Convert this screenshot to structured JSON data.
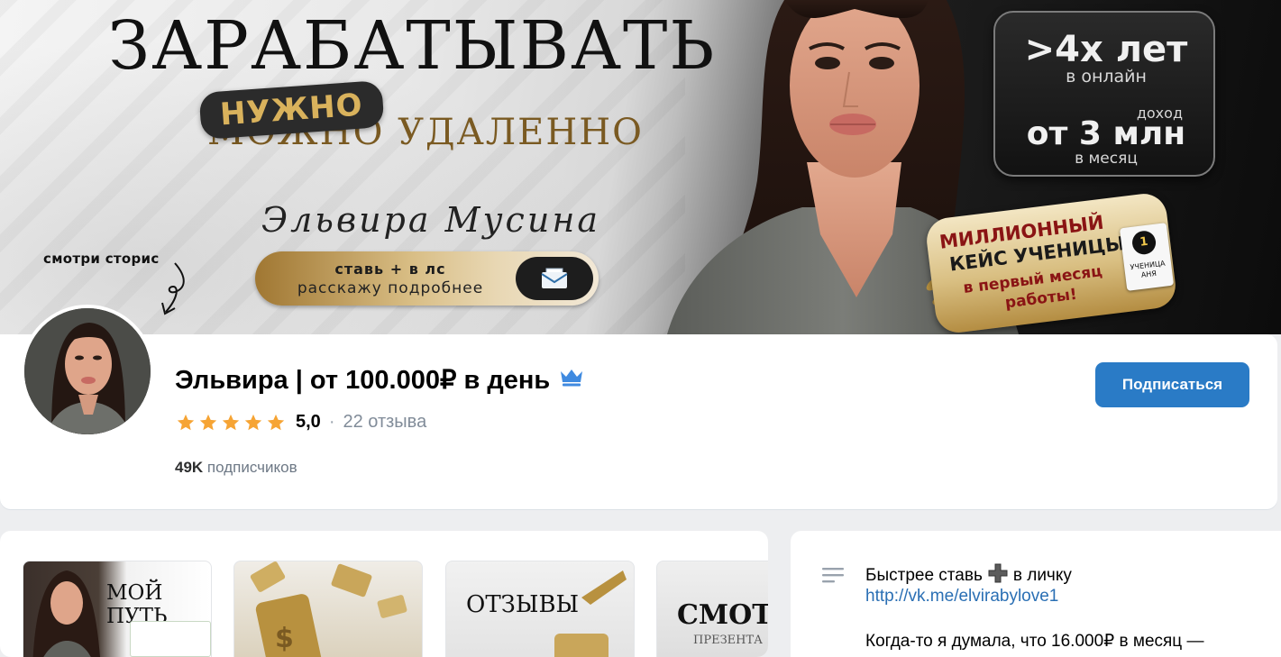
{
  "cover": {
    "headline": "ЗАРАБАТЫВАТЬ",
    "badge": "НУЖНО",
    "subline": "МОЖНО УДАЛЕННО",
    "signature": "Эльвира Мусина",
    "cta_line1": "ставь + в лс",
    "cta_line2": "расскажу подробнее",
    "watch_stories": "смотри сторис",
    "stat_years": ">4х лет",
    "stat_years_sub": "в онлайн",
    "stat_income_pre": "доход",
    "stat_income": "от 3 млн",
    "stat_income_sub": "в месяц",
    "case_l1": "МИЛЛИОННЫЙ",
    "case_l2": "КЕЙС УЧЕНИЦЫ",
    "case_l3": "в первый месяц",
    "case_l4": "работы!",
    "case_photo_num": "1",
    "case_photo_caption": "УЧЕНИЦА АНЯ"
  },
  "profile": {
    "name": "Эльвира | от 100.000₽ в день",
    "rating_value": "5,0",
    "rating_stars": 5,
    "rating_separator": "·",
    "reviews": "22 отзыва",
    "followers_count": "49K",
    "followers_label": "подписчиков",
    "subscribe_label": "Подписаться",
    "verified_icon": "crown-icon"
  },
  "media": {
    "thumbs": [
      {
        "label": "МОЙ ПУТЬ"
      },
      {
        "label": ""
      },
      {
        "label": "ОТЗЫВЫ"
      },
      {
        "label": "СМОТР",
        "sublabel": "ПРЕЗЕНТА"
      }
    ]
  },
  "info": {
    "line1_before": "Быстрее ставь",
    "line1_after": "в личку",
    "link": "http://vk.me/elvirabylove1",
    "line3": "Когда-то я думала, что 16.000₽ в месяц —"
  },
  "colors": {
    "accent": "#2a7bc6",
    "link": "#2a6fb4",
    "star": "#f6a434",
    "crown": "#3f8ae0",
    "background": "#edeef0"
  }
}
